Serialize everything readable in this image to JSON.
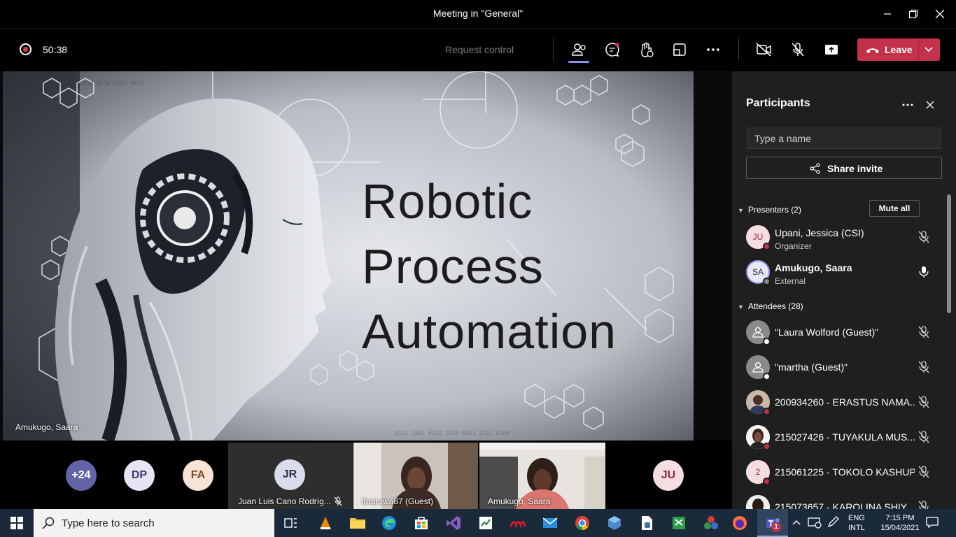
{
  "window": {
    "title": "Meeting in \"General\""
  },
  "toolbar": {
    "timer": "50:38",
    "request_control": "Request control",
    "leave_label": "Leave"
  },
  "stage": {
    "slide_lines": [
      "Robotic",
      "Process",
      "Automation"
    ],
    "presenter_name": "Amukugo, Saara"
  },
  "strip": {
    "overflow_count": "+24",
    "avatars": [
      {
        "initials": "DP",
        "color": "#e8e4f4",
        "text_color": "#3d3a73"
      },
      {
        "initials": "FA",
        "color": "#f8e4d4",
        "text_color": "#7a4a22"
      }
    ],
    "tiles": [
      {
        "initials": "JR",
        "name": "Juan Luis Cano Rodríg..."
      },
      {
        "name": "ifnarowa87 (Guest)"
      },
      {
        "name": "Amukugo, Saara"
      },
      {
        "initials": "JU"
      }
    ]
  },
  "panel": {
    "title": "Participants",
    "search_placeholder": "Type a name",
    "share_invite": "Share invite",
    "presenters_label": "Presenters (2)",
    "mute_all": "Mute all",
    "attendees_label": "Attendees (28)",
    "presenters": [
      {
        "initials": "JU",
        "name": "Upani, Jessica (CSI)",
        "role": "Organizer",
        "mic": "muted"
      },
      {
        "initials": "SA",
        "name": "Amukugo, Saara",
        "role": "External",
        "mic": "on"
      }
    ],
    "attendees": [
      {
        "name": "\"Laura Wolford (Guest)\"",
        "avatar": "guest-icon",
        "mic": "muted"
      },
      {
        "name": "\"martha (Guest)\"",
        "avatar": "guest-icon",
        "mic": "muted"
      },
      {
        "name": "200934260 - ERASTUS NAMA...",
        "avatar": "photo",
        "mic": "muted"
      },
      {
        "name": "215027426 - TUYAKULA MUS...",
        "avatar": "photo",
        "mic": "muted"
      },
      {
        "name": "215061225 - TOKOLO KASHUPI",
        "avatar": "2",
        "mic": "muted"
      },
      {
        "name": "215073657 - KAROLINA SHIY...",
        "avatar": "photo",
        "mic": "muted"
      }
    ]
  },
  "taskbar": {
    "search_placeholder": "Type here to search",
    "lang_1": "ENG",
    "lang_2": "INTL",
    "time": "7:15 PM",
    "date": "15/04/2021",
    "teams_badge": "1"
  },
  "colors": {
    "accent": "#8f92e8",
    "leave": "#c4314b",
    "panel": "#1f1f1f",
    "busy": "#c4314b"
  }
}
